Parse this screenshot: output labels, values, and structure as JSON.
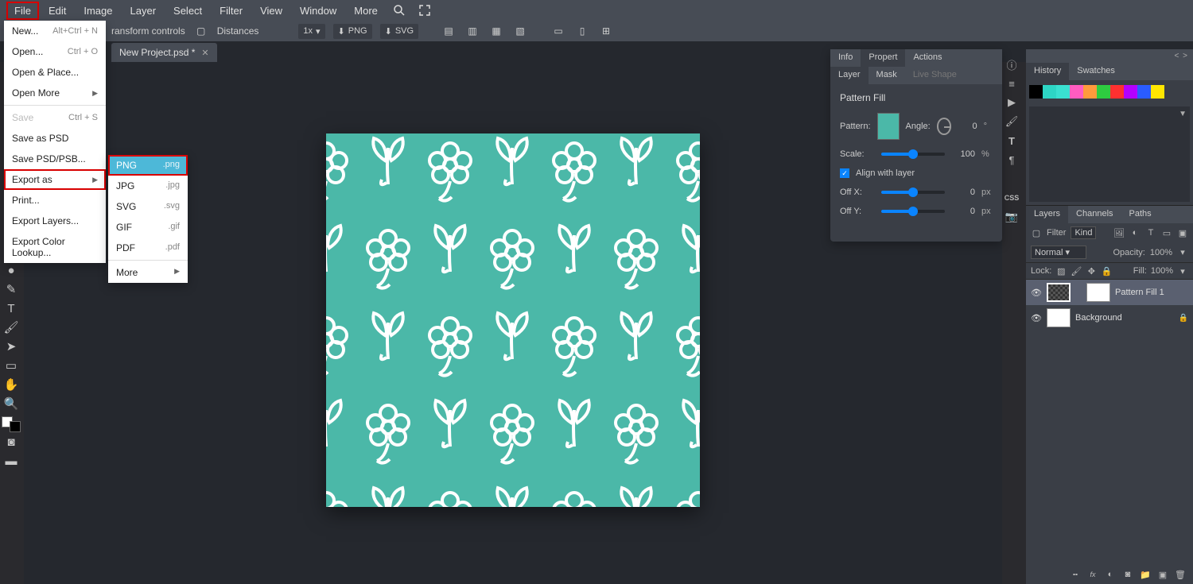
{
  "menubar": {
    "items": [
      "File",
      "Edit",
      "Image",
      "Layer",
      "Select",
      "Filter",
      "View",
      "Window",
      "More"
    ]
  },
  "optbar": {
    "transform": "ransform controls",
    "distances": "Distances",
    "zoom": "1x",
    "png": "PNG",
    "svg": "SVG"
  },
  "tab": {
    "name": "New Project.psd *"
  },
  "filemenu": [
    {
      "label": "New...",
      "shortcut": "Alt+Ctrl + N"
    },
    {
      "label": "Open...",
      "shortcut": "Ctrl + O"
    },
    {
      "label": "Open & Place..."
    },
    {
      "label": "Open More",
      "submenu": true
    },
    {
      "sep": true
    },
    {
      "label": "Save",
      "shortcut": "Ctrl + S",
      "disabled": true
    },
    {
      "label": "Save as PSD"
    },
    {
      "label": "Save PSD/PSB..."
    },
    {
      "label": "Export as",
      "submenu": true,
      "highlighted": true
    },
    {
      "label": "Print..."
    },
    {
      "label": "Export Layers..."
    },
    {
      "label": "Export Color Lookup..."
    }
  ],
  "exportmenu": [
    {
      "label": "PNG",
      "ext": ".png",
      "selected": true
    },
    {
      "label": "JPG",
      "ext": ".jpg"
    },
    {
      "label": "SVG",
      "ext": ".svg"
    },
    {
      "label": "GIF",
      "ext": ".gif"
    },
    {
      "label": "PDF",
      "ext": ".pdf"
    },
    {
      "sep": true
    },
    {
      "label": "More",
      "submenu": true
    }
  ],
  "props": {
    "tabs": [
      "Info",
      "Propert",
      "Actions"
    ],
    "subtabs": [
      "Layer",
      "Mask",
      "Live Shape"
    ],
    "title": "Pattern Fill",
    "pattern_label": "Pattern:",
    "angle_label": "Angle:",
    "angle_val": "0",
    "angle_unit": "°",
    "scale_label": "Scale:",
    "scale_val": "100",
    "scale_unit": "%",
    "align_label": "Align with layer",
    "offx_label": "Off X:",
    "offx_val": "0",
    "offx_unit": "px",
    "offy_label": "Off Y:",
    "offy_val": "0",
    "offy_unit": "px"
  },
  "rightdock": {
    "collapse": "< >",
    "history_tabs": [
      "History",
      "Swatches"
    ],
    "swatches": [
      "#000000",
      "#4bb8a8",
      "#2dd6c5",
      "#ff5cc0",
      "#ff9a3c",
      "#2ecc40",
      "#ff3030",
      "#b300ff",
      "#2a5cff",
      "#ffe600"
    ],
    "layers_tabs": [
      "Layers",
      "Channels",
      "Paths"
    ],
    "filter_label": "Filter",
    "kind_label": "Kind",
    "blend": "Normal",
    "opacity_label": "Opacity:",
    "opacity_val": "100%",
    "lock_label": "Lock:",
    "fill_label": "Fill:",
    "fill_val": "100%",
    "layer1": "Pattern Fill 1",
    "layer2": "Background"
  }
}
